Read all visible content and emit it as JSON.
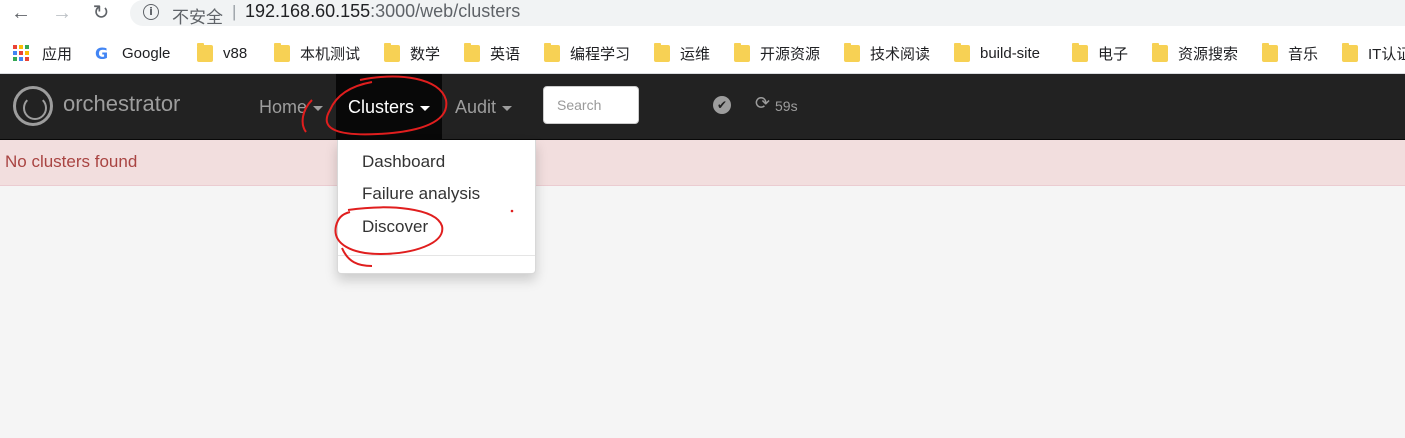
{
  "browser": {
    "back_icon": "←",
    "forward_icon": "→",
    "reload_icon": "↻",
    "info_icon": "i",
    "security_label": "不安全",
    "url_separator": "|",
    "url_host": "192.168.60.155",
    "url_path": ":3000/web/clusters",
    "bookmarks": [
      {
        "label": "应用",
        "icon": "apps-grid"
      },
      {
        "label": "Google",
        "icon": "google-logo"
      },
      {
        "label": "v88",
        "icon": "folder"
      },
      {
        "label": "本机测试",
        "icon": "folder"
      },
      {
        "label": "数学",
        "icon": "folder"
      },
      {
        "label": "英语",
        "icon": "folder"
      },
      {
        "label": "编程学习",
        "icon": "folder"
      },
      {
        "label": "运维",
        "icon": "folder"
      },
      {
        "label": "开源资源",
        "icon": "folder"
      },
      {
        "label": "技术阅读",
        "icon": "folder"
      },
      {
        "label": "build-site",
        "icon": "folder"
      },
      {
        "label": "电子",
        "icon": "folder"
      },
      {
        "label": "资源搜索",
        "icon": "folder"
      },
      {
        "label": "音乐",
        "icon": "folder"
      },
      {
        "label": "IT认证",
        "icon": "folder"
      }
    ],
    "google_glyph": "G"
  },
  "navbar": {
    "brand": "orchestrator",
    "menus": [
      {
        "label": "Home",
        "active": false
      },
      {
        "label": "Clusters",
        "active": true
      },
      {
        "label": "Audit",
        "active": false
      }
    ],
    "search_placeholder": "Search",
    "check_glyph": "✔",
    "refresh_glyph": "⟳",
    "countdown": "59s"
  },
  "alert": {
    "message": "No clusters found"
  },
  "clusters_menu": {
    "items": [
      "Dashboard",
      "Failure analysis",
      "Discover"
    ]
  },
  "colors": {
    "navbar_bg": "#222222",
    "navbar_active_bg": "#080808",
    "alert_bg": "#f2dede",
    "alert_text": "#a94442",
    "annotation": "#e01e1e"
  }
}
